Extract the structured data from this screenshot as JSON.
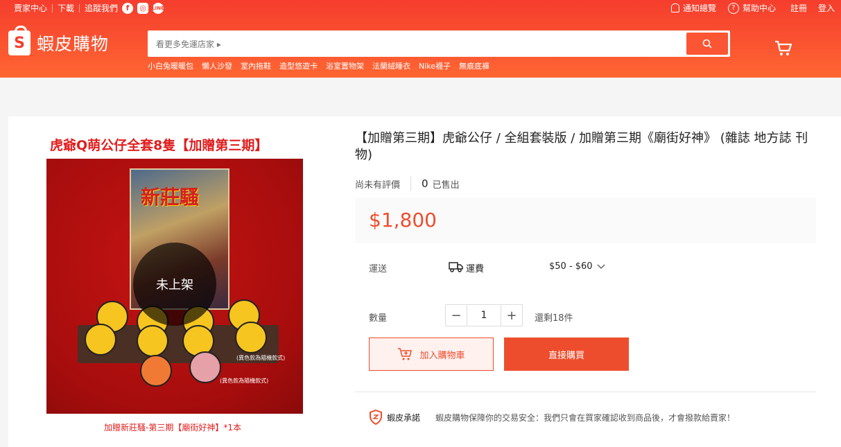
{
  "topbar": {
    "seller_center": "賣家中心",
    "download": "下載",
    "follow_us": "追蹤我們",
    "social_icons": [
      "facebook-icon",
      "instagram-icon",
      "line-icon"
    ],
    "notifications": "通知總覽",
    "help": "幫助中心",
    "register": "註冊",
    "login": "登入"
  },
  "header": {
    "logo_text": "蝦皮購物",
    "logo_mark": "S",
    "search_placeholder": "看更多免運店家 ▸",
    "keywords": [
      "小白兔暖暖包",
      "懶人沙發",
      "室內拖鞋",
      "造型悠遊卡",
      "浴室置物架",
      "法蘭絨睡衣",
      "Nike襪子",
      "無痕底褲"
    ],
    "brand_color": "#ee4d2d"
  },
  "product": {
    "image_title": "虎爺Q萌公仔全套8隻【加贈第三期】",
    "book_title": "新莊騷",
    "note_1": "(異色款為隨機款式)",
    "note_2": "(異色款為隨機款式)",
    "overlay_text": "未上架",
    "image_caption": "加贈新莊騷-第三期【廟街好神】*1本",
    "title": "【加贈第三期】虎爺公仔 / 全組套裝版 / 加贈第三期《廟街好神》 (雜誌 地方誌 刊物)",
    "no_rating": "尚未有評價",
    "sold_count": "0",
    "sold_label": "已售出",
    "price": "$1,800",
    "shipping_label": "運送",
    "shipping_type": "運費",
    "shipping_fee": "$50 - $60",
    "quantity_label": "數量",
    "quantity_value": "1",
    "stock_text": "還剩18件",
    "add_to_cart": "加入購物車",
    "buy_now": "直接購買",
    "guarantee_label": "蝦皮承諾",
    "guarantee_text": "蝦皮購物保障你的交易安全：我們只會在買家確認收到商品後，才會撥款給賣家！"
  }
}
